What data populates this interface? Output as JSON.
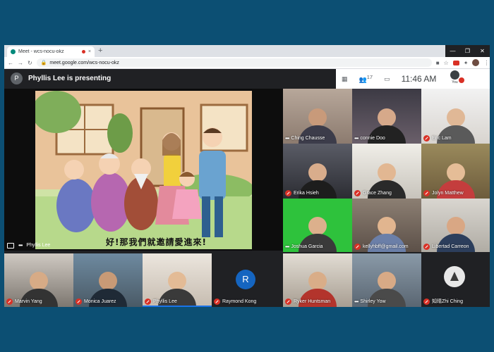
{
  "browser": {
    "tab_title": "Meet - wcs-nocu-okz",
    "tab_close": "×",
    "new_tab": "+",
    "url": "meet.google.com/wcs-nocu-okz",
    "back": "←",
    "forward": "→",
    "reload": "↻",
    "window_controls": [
      "—",
      "❐",
      "✕"
    ]
  },
  "meet": {
    "presenter_initial": "P",
    "presenting_title": "Phyllis Lee is presenting",
    "participant_count": "17",
    "time": "11:46 AM",
    "you_label": "You"
  },
  "presentation": {
    "caption": "好!那我們就邀請愛進來!",
    "presenter_name": "Phyllis Lee"
  },
  "participants": [
    {
      "name": "Ching Chausse"
    },
    {
      "name": "connie Doo"
    },
    {
      "name": "Eric Lam"
    },
    {
      "name": "Erika Hsieh"
    },
    {
      "name": "Grace Zhang"
    },
    {
      "name": "Jolyn Matthew"
    },
    {
      "name": "Joshua Garcia"
    },
    {
      "name": "kellyhbff@gmail.com"
    },
    {
      "name": "Libertad Carreon"
    },
    {
      "name": "Marvin Yang"
    },
    {
      "name": "Monica Juarez"
    },
    {
      "name": "Phyllis Lee"
    },
    {
      "name": "Raymond Kong",
      "initial": "R"
    },
    {
      "name": "Ryker Huntsman"
    },
    {
      "name": "Shirley Yow"
    },
    {
      "name": "知晴Zhi Ching"
    }
  ],
  "colors": {
    "page_bg": "#0c4f73",
    "meet_bg": "#202124",
    "mic_off": "#d93025",
    "accent": "#1a73e8"
  }
}
